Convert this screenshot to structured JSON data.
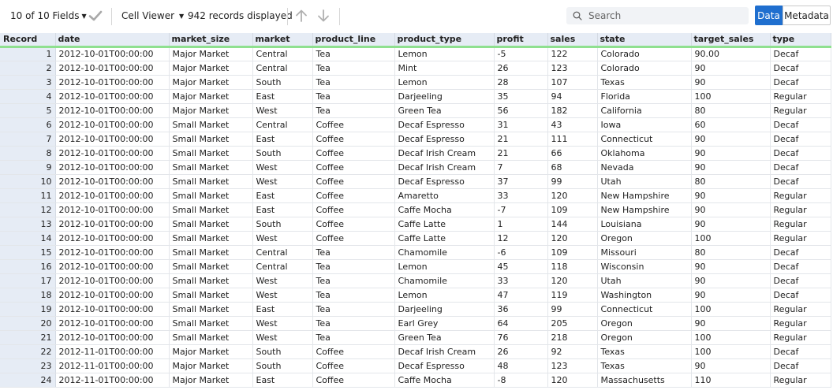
{
  "toolbar": {
    "fields_label": "10 of 10 Fields",
    "viewer_label": "Cell Viewer",
    "records_label": "942 records displayed",
    "search_placeholder": "Search",
    "tab_data": "Data",
    "tab_metadata": "Metadata",
    "accent": "#1f6fcf"
  },
  "table": {
    "columns": [
      "Record",
      "date",
      "market_size",
      "market",
      "product_line",
      "product_type",
      "profit",
      "sales",
      "state",
      "target_sales",
      "type"
    ],
    "rows": [
      [
        "1",
        "2012-10-01T00:00:00",
        "Major Market",
        "Central",
        "Tea",
        "Lemon",
        "-5",
        "122",
        "Colorado",
        "90.00",
        "Decaf"
      ],
      [
        "2",
        "2012-10-01T00:00:00",
        "Major Market",
        "Central",
        "Tea",
        "Mint",
        "26",
        "123",
        "Colorado",
        "90",
        "Decaf"
      ],
      [
        "3",
        "2012-10-01T00:00:00",
        "Major Market",
        "South",
        "Tea",
        "Lemon",
        "28",
        "107",
        "Texas",
        "90",
        "Decaf"
      ],
      [
        "4",
        "2012-10-01T00:00:00",
        "Major Market",
        "East",
        "Tea",
        "Darjeeling",
        "35",
        "94",
        "Florida",
        "100",
        "Regular"
      ],
      [
        "5",
        "2012-10-01T00:00:00",
        "Major Market",
        "West",
        "Tea",
        "Green Tea",
        "56",
        "182",
        "California",
        "80",
        "Regular"
      ],
      [
        "6",
        "2012-10-01T00:00:00",
        "Small Market",
        "Central",
        "Coffee",
        "Decaf Espresso",
        "31",
        "43",
        "Iowa",
        "60",
        "Decaf"
      ],
      [
        "7",
        "2012-10-01T00:00:00",
        "Small Market",
        "East",
        "Coffee",
        "Decaf Espresso",
        "21",
        "111",
        "Connecticut",
        "90",
        "Decaf"
      ],
      [
        "8",
        "2012-10-01T00:00:00",
        "Small Market",
        "South",
        "Coffee",
        "Decaf Irish Cream",
        "21",
        "66",
        "Oklahoma",
        "90",
        "Decaf"
      ],
      [
        "9",
        "2012-10-01T00:00:00",
        "Small Market",
        "West",
        "Coffee",
        "Decaf Irish Cream",
        "7",
        "68",
        "Nevada",
        "90",
        "Decaf"
      ],
      [
        "10",
        "2012-10-01T00:00:00",
        "Small Market",
        "West",
        "Coffee",
        "Decaf Espresso",
        "37",
        "99",
        "Utah",
        "80",
        "Decaf"
      ],
      [
        "11",
        "2012-10-01T00:00:00",
        "Small Market",
        "East",
        "Coffee",
        "Amaretto",
        "33",
        "120",
        "New Hampshire",
        "90",
        "Regular"
      ],
      [
        "12",
        "2012-10-01T00:00:00",
        "Small Market",
        "East",
        "Coffee",
        "Caffe Mocha",
        "-7",
        "109",
        "New Hampshire",
        "90",
        "Regular"
      ],
      [
        "13",
        "2012-10-01T00:00:00",
        "Small Market",
        "South",
        "Coffee",
        "Caffe Latte",
        "1",
        "144",
        "Louisiana",
        "90",
        "Regular"
      ],
      [
        "14",
        "2012-10-01T00:00:00",
        "Small Market",
        "West",
        "Coffee",
        "Caffe Latte",
        "12",
        "120",
        "Oregon",
        "100",
        "Regular"
      ],
      [
        "15",
        "2012-10-01T00:00:00",
        "Small Market",
        "Central",
        "Tea",
        "Chamomile",
        "-6",
        "109",
        "Missouri",
        "80",
        "Decaf"
      ],
      [
        "16",
        "2012-10-01T00:00:00",
        "Small Market",
        "Central",
        "Tea",
        "Lemon",
        "45",
        "118",
        "Wisconsin",
        "90",
        "Decaf"
      ],
      [
        "17",
        "2012-10-01T00:00:00",
        "Small Market",
        "West",
        "Tea",
        "Chamomile",
        "33",
        "120",
        "Utah",
        "90",
        "Decaf"
      ],
      [
        "18",
        "2012-10-01T00:00:00",
        "Small Market",
        "West",
        "Tea",
        "Lemon",
        "47",
        "119",
        "Washington",
        "90",
        "Decaf"
      ],
      [
        "19",
        "2012-10-01T00:00:00",
        "Small Market",
        "East",
        "Tea",
        "Darjeeling",
        "36",
        "99",
        "Connecticut",
        "100",
        "Regular"
      ],
      [
        "20",
        "2012-10-01T00:00:00",
        "Small Market",
        "West",
        "Tea",
        "Earl Grey",
        "64",
        "205",
        "Oregon",
        "90",
        "Regular"
      ],
      [
        "21",
        "2012-10-01T00:00:00",
        "Small Market",
        "West",
        "Tea",
        "Green Tea",
        "76",
        "218",
        "Oregon",
        "100",
        "Regular"
      ],
      [
        "22",
        "2012-11-01T00:00:00",
        "Major Market",
        "South",
        "Coffee",
        "Decaf Irish Cream",
        "26",
        "92",
        "Texas",
        "100",
        "Decaf"
      ],
      [
        "23",
        "2012-11-01T00:00:00",
        "Major Market",
        "South",
        "Coffee",
        "Decaf Espresso",
        "48",
        "123",
        "Texas",
        "90",
        "Decaf"
      ],
      [
        "24",
        "2012-11-01T00:00:00",
        "Major Market",
        "East",
        "Coffee",
        "Caffe Mocha",
        "-8",
        "120",
        "Massachusetts",
        "110",
        "Regular"
      ]
    ]
  }
}
